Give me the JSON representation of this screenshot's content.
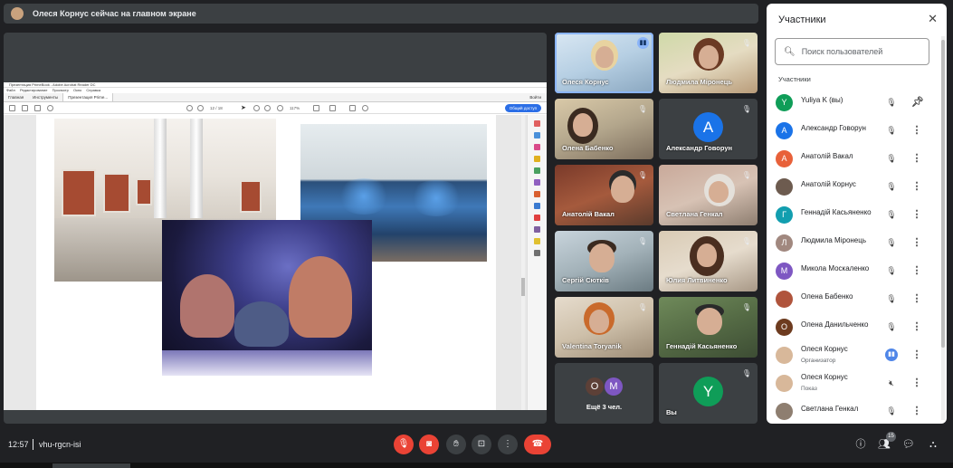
{
  "banner": {
    "text": "Олеся Корнус сейчас на главном экране"
  },
  "presentation": {
    "acrobat_title": "Презентация PrimeBook - Adobe Acrobat Reader DC",
    "menu": [
      "Файл",
      "Редактирование",
      "Просмотр",
      "Окно",
      "Справка"
    ],
    "tabs": [
      "Главная",
      "Инструменты",
      "Презентация Prime..."
    ],
    "signin": "Войти",
    "share": "Общий доступ",
    "page": "12 / 18",
    "zoom": "117%"
  },
  "tiles": [
    {
      "name": "Олеся Корнус",
      "speaking": true
    },
    {
      "name": "Людмила Міронець"
    },
    {
      "name": "Олена Бабенко"
    },
    {
      "name": "Александр Говорун",
      "initial": "А",
      "color": "#1a73e8"
    },
    {
      "name": "Анатолій Вакал"
    },
    {
      "name": "Светлана Генкал"
    },
    {
      "name": "Сергій Сютків"
    },
    {
      "name": "Юлия Литвиненко"
    },
    {
      "name": "Valentina Toryanik"
    },
    {
      "name": "Геннадій Касьяненко"
    },
    {
      "name": "Ещё 3 чел.",
      "initials": [
        "О",
        "М"
      ]
    },
    {
      "name": "Вы",
      "initial": "Y",
      "color": "#0f9d58"
    }
  ],
  "participants_panel": {
    "title": "Участники",
    "search_placeholder": "Поиск пользователей",
    "section": "Участники",
    "count_badge": "15",
    "people": [
      {
        "name": "Yuliya K (вы)",
        "initial": "Y",
        "color": "#0f9d58",
        "action": "pin-icon"
      },
      {
        "name": "Александр Говорун",
        "initial": "А",
        "color": "#1a73e8"
      },
      {
        "name": "Анатолій Вакал",
        "initial": "А",
        "color": "#e8613a"
      },
      {
        "name": "Анатолій Корнус",
        "photo": true,
        "color": "#6d5b4f"
      },
      {
        "name": "Геннадій Касьяненко",
        "initial": "Г",
        "color": "#129eaf"
      },
      {
        "name": "Людмила Міронець",
        "initial": "Л",
        "color": "#a1887f"
      },
      {
        "name": "Микола Москаленко",
        "initial": "М",
        "color": "#7e57c2"
      },
      {
        "name": "Олена Бабенко",
        "photo": true,
        "color": "#b0543c"
      },
      {
        "name": "Олена Данильченко",
        "initial": "О",
        "color": "#6d3b1f"
      },
      {
        "name": "Олеся Корнус",
        "sub": "Организатор",
        "photo": true,
        "color": "#d8b89a",
        "mic": "active"
      },
      {
        "name": "Олеся Корнус",
        "sub": "Показ",
        "photo": true,
        "color": "#d8b89a",
        "mic": "screen"
      },
      {
        "name": "Светлана Генкал",
        "photo": true,
        "color": "#8e7e70"
      }
    ]
  },
  "bottom": {
    "time": "12:57",
    "meeting_code": "vhu-rgcn-isi"
  }
}
